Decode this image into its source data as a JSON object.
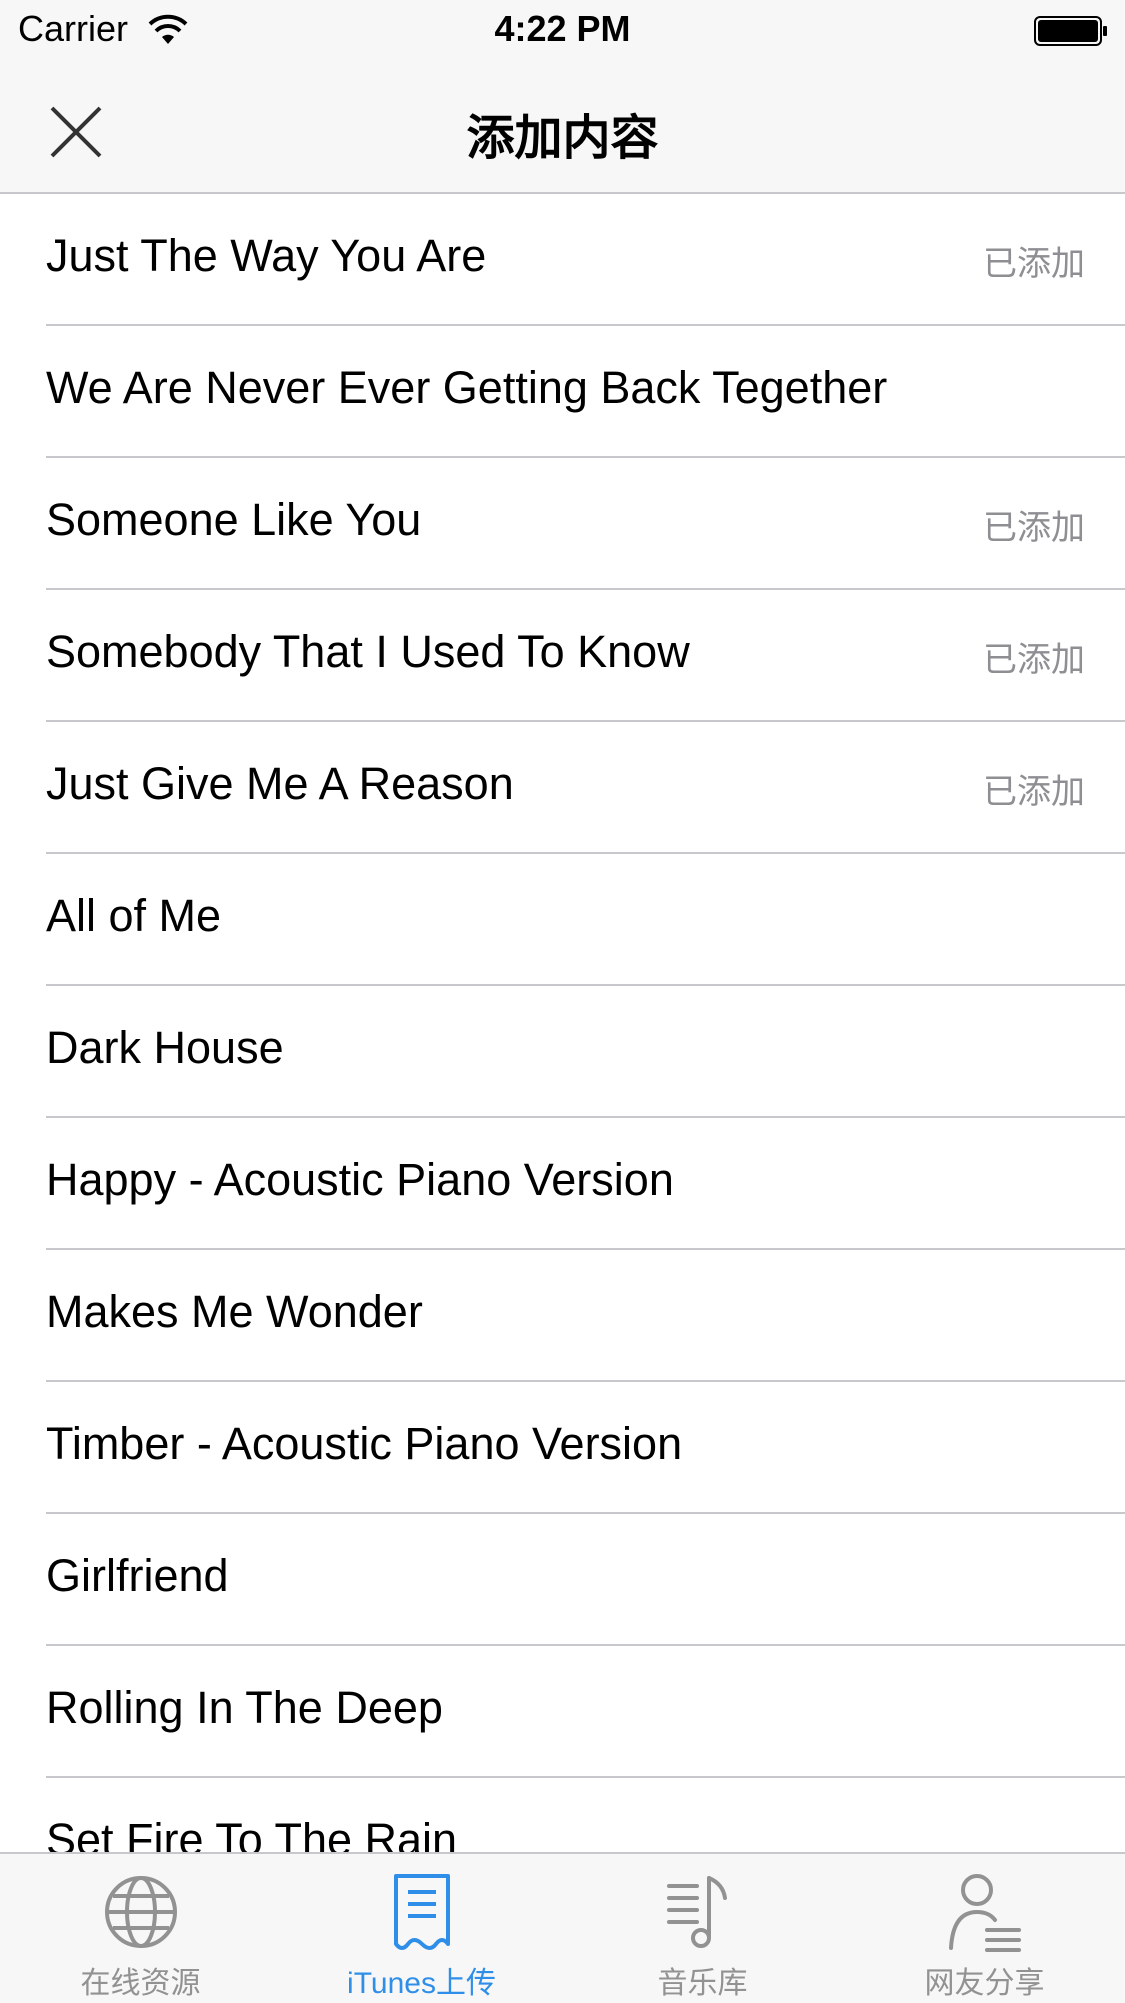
{
  "status_bar": {
    "carrier": "Carrier",
    "time": "4:22 PM",
    "wifi_icon": "wifi-icon",
    "battery_icon": "battery-icon"
  },
  "nav": {
    "title": "添加内容",
    "close_icon": "close-icon"
  },
  "songs": [
    {
      "title": "Just The Way You Are",
      "status": "已添加"
    },
    {
      "title": "We Are Never Ever Getting Back Tegether",
      "status": ""
    },
    {
      "title": "Someone Like You",
      "status": "已添加"
    },
    {
      "title": "Somebody That I Used To Know",
      "status": "已添加"
    },
    {
      "title": "Just Give Me A Reason",
      "status": "已添加"
    },
    {
      "title": "All of Me",
      "status": ""
    },
    {
      "title": "Dark House",
      "status": ""
    },
    {
      "title": "Happy - Acoustic Piano Version",
      "status": ""
    },
    {
      "title": "Makes Me Wonder",
      "status": ""
    },
    {
      "title": "Timber - Acoustic Piano Version",
      "status": ""
    },
    {
      "title": "Girlfriend",
      "status": ""
    },
    {
      "title": "Rolling In The Deep",
      "status": ""
    },
    {
      "title": "Set Fire To The Rain",
      "status": ""
    }
  ],
  "tabs": [
    {
      "label": "在线资源",
      "icon": "globe-icon",
      "active": false
    },
    {
      "label": "iTunes上传",
      "icon": "document-icon",
      "active": true
    },
    {
      "label": "音乐库",
      "icon": "music-list-icon",
      "active": false
    },
    {
      "label": "网友分享",
      "icon": "user-share-icon",
      "active": false
    }
  ],
  "colors": {
    "accent": "#2f8fe8",
    "inactive": "#929292",
    "bar_background": "#f7f7f7",
    "separator": "#c8c7cc"
  }
}
